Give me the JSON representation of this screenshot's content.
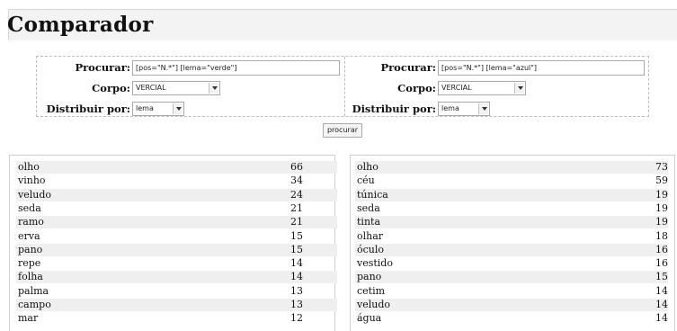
{
  "app": {
    "title": "Comparador",
    "corner_mark": "-"
  },
  "form": {
    "left": {
      "search_label": "Procurar:",
      "search_value": "[pos=\"N.*\"] [lema=\"verde\"]",
      "corpus_label": "Corpo:",
      "corpus_value": "VERCIAL",
      "distribute_label": "Distribuir por:",
      "distribute_value": "lema"
    },
    "right": {
      "search_label": "Procurar:",
      "search_value": "[pos=\"N.*\"] [lema=\"azul\"]",
      "corpus_label": "Corpo:",
      "corpus_value": "VERCIAL",
      "distribute_label": "Distribuir por:",
      "distribute_value": "lema"
    },
    "submit_label": "procurar"
  },
  "results": {
    "left": [
      {
        "word": "olho",
        "count": "66"
      },
      {
        "word": "vinho",
        "count": "34"
      },
      {
        "word": "veludo",
        "count": "24"
      },
      {
        "word": "seda",
        "count": "21"
      },
      {
        "word": "ramo",
        "count": "21"
      },
      {
        "word": "erva",
        "count": "15"
      },
      {
        "word": "pano",
        "count": "15"
      },
      {
        "word": "repe",
        "count": "14"
      },
      {
        "word": "folha",
        "count": "14"
      },
      {
        "word": "palma",
        "count": "13"
      },
      {
        "word": "campo",
        "count": "13"
      },
      {
        "word": "mar",
        "count": "12"
      }
    ],
    "right": [
      {
        "word": "olho",
        "count": "73"
      },
      {
        "word": "céu",
        "count": "59"
      },
      {
        "word": "túnica",
        "count": "19"
      },
      {
        "word": "seda",
        "count": "19"
      },
      {
        "word": "tinta",
        "count": "19"
      },
      {
        "word": "olhar",
        "count": "18"
      },
      {
        "word": "óculo",
        "count": "16"
      },
      {
        "word": "vestido",
        "count": "16"
      },
      {
        "word": "pano",
        "count": "15"
      },
      {
        "word": "cetim",
        "count": "14"
      },
      {
        "word": "veludo",
        "count": "14"
      },
      {
        "word": "água",
        "count": "14"
      }
    ]
  },
  "colors": {
    "row_alt": "#efefef",
    "header_bg": "#f3f3f3"
  }
}
